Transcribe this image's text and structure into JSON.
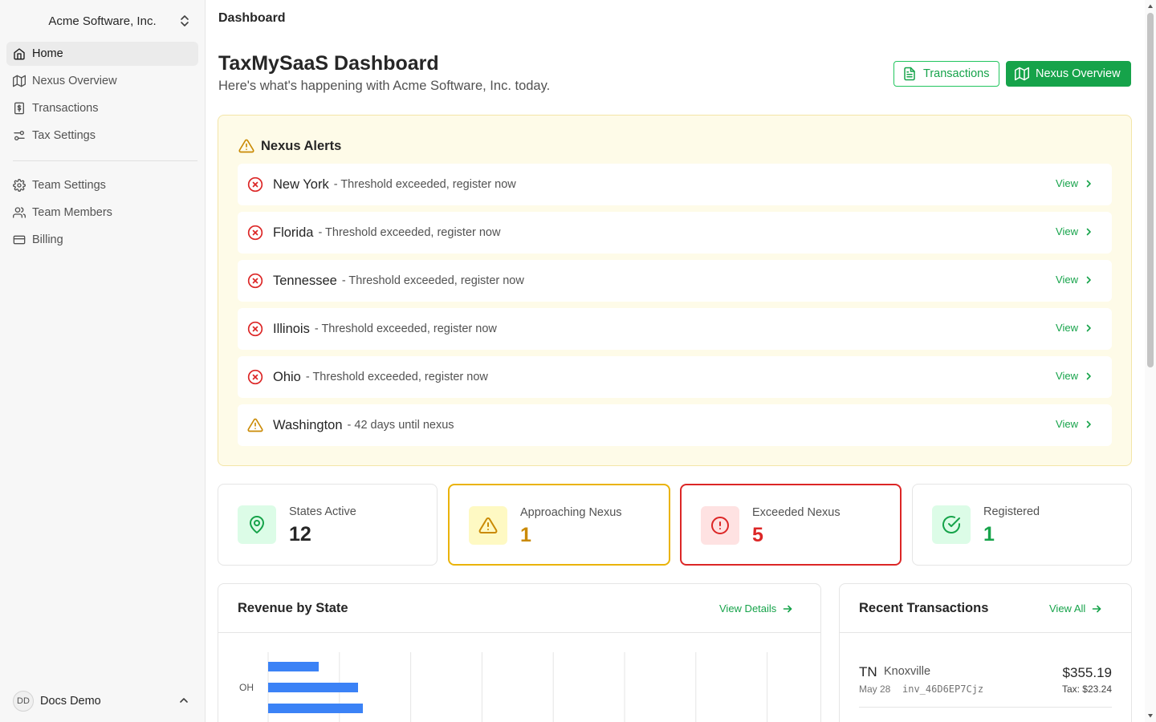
{
  "org": {
    "name": "Acme Software, Inc."
  },
  "nav": {
    "primary": [
      {
        "label": "Home",
        "icon": "home-icon",
        "active": true
      },
      {
        "label": "Nexus Overview",
        "icon": "map-icon"
      },
      {
        "label": "Transactions",
        "icon": "receipt-icon"
      },
      {
        "label": "Tax Settings",
        "icon": "sliders-icon"
      }
    ],
    "secondary": [
      {
        "label": "Team Settings",
        "icon": "gear-icon"
      },
      {
        "label": "Team Members",
        "icon": "users-icon"
      },
      {
        "label": "Billing",
        "icon": "credit-card-icon"
      }
    ]
  },
  "user": {
    "initials": "DD",
    "name": "Docs Demo"
  },
  "breadcrumb": "Dashboard",
  "page": {
    "title": "TaxMySaaS Dashboard",
    "subtitle": "Here's what's happening with Acme Software, Inc. today.",
    "transactions_button": "Transactions",
    "nexus_button": "Nexus Overview"
  },
  "alerts": {
    "title": "Nexus Alerts",
    "view_label": "View",
    "items": [
      {
        "state": "New York",
        "message": "- Threshold exceeded, register now",
        "level": "error"
      },
      {
        "state": "Florida",
        "message": "- Threshold exceeded, register now",
        "level": "error"
      },
      {
        "state": "Tennessee",
        "message": "- Threshold exceeded, register now",
        "level": "error"
      },
      {
        "state": "Illinois",
        "message": "- Threshold exceeded, register now",
        "level": "error"
      },
      {
        "state": "Ohio",
        "message": "- Threshold exceeded, register now",
        "level": "error"
      },
      {
        "state": "Washington",
        "message": "- 42 days until nexus",
        "level": "warning"
      }
    ]
  },
  "stats": [
    {
      "label": "States Active",
      "value": "12",
      "icon": "map-pin-icon",
      "color": "#16a34a"
    },
    {
      "label": "Approaching Nexus",
      "value": "1",
      "icon": "warning-icon",
      "color": "#ca8a04"
    },
    {
      "label": "Exceeded Nexus",
      "value": "5",
      "icon": "alert-circle-icon",
      "color": "#dc2626"
    },
    {
      "label": "Registered",
      "value": "1",
      "icon": "check-circle-icon",
      "color": "#16a34a"
    }
  ],
  "revenue": {
    "title": "Revenue by State",
    "link": "View Details",
    "chart_data": {
      "type": "bar",
      "orientation": "horizontal",
      "categories": [
        "OH"
      ],
      "series": [
        {
          "values": [
            63
          ]
        },
        {
          "values": [
            112
          ]
        },
        {
          "values": [
            118
          ]
        }
      ],
      "grid": true
    }
  },
  "recent": {
    "title": "Recent Transactions",
    "link": "View All",
    "items": [
      {
        "state": "TN",
        "city": "Knoxville",
        "date": "May 28",
        "invoice": "inv_46D6EP7Cjz",
        "amount": "$355.19",
        "tax": "Tax: $23.24"
      }
    ]
  },
  "colors": {
    "accent": "#16a34a",
    "warning": "#eab308",
    "error": "#dc2626",
    "chart": "#3b82f6"
  }
}
